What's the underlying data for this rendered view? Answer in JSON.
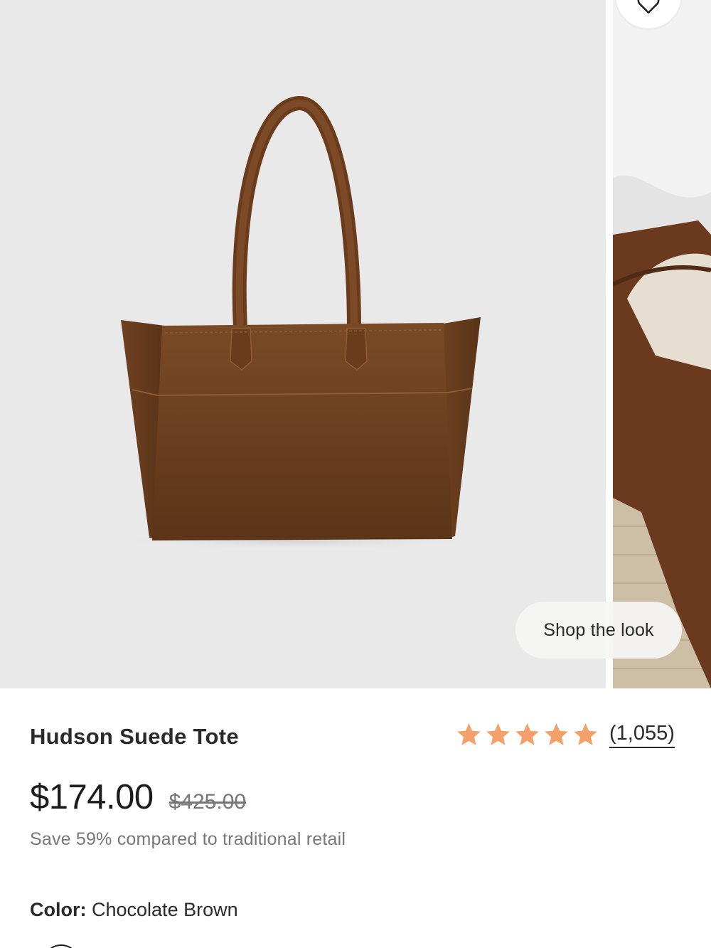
{
  "gallery": {
    "main_image_alt": "Hudson Suede Tote product image",
    "shop_look_label": "Shop the look",
    "favorite_icon": "heart-icon"
  },
  "product": {
    "title": "Hudson Suede Tote",
    "rating": {
      "stars": 5,
      "max": 5,
      "star_color": "#f4a06a",
      "count_label": "(1,055)"
    },
    "price": "$174.00",
    "compare_price": "$425.00",
    "savings_text": "Save 59% compared to traditional retail",
    "color": {
      "label": "Color:",
      "value": "Chocolate Brown"
    }
  }
}
